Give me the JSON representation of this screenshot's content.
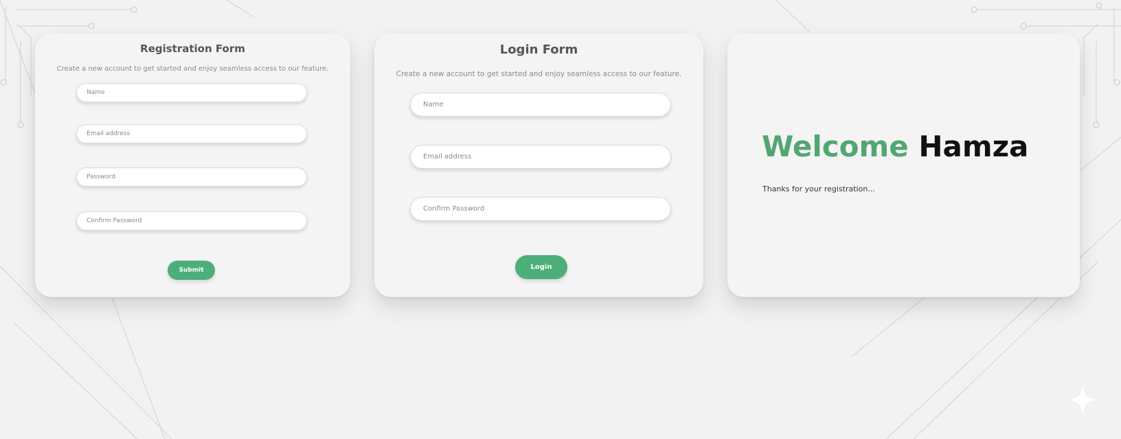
{
  "registration": {
    "title": "Registration Form",
    "subtitle": "Create a new account to get started and enjoy seamless access to our feature.",
    "name_placeholder": "Name",
    "email_placeholder": "Email address",
    "password_placeholder": "Password",
    "confirm_placeholder": "Confirm Password",
    "submit_label": "Submit"
  },
  "login": {
    "title": "Login Form",
    "subtitle": "Create a new account to get started and enjoy seamless access to our feature.",
    "name_placeholder": "Name",
    "email_placeholder": "Email address",
    "confirm_placeholder": "Confirm Password",
    "login_label": "Login"
  },
  "welcome": {
    "greeting": "Welcome",
    "name": "Hamza",
    "message": "Thanks for your registration..."
  },
  "colors": {
    "accent_green": "#4caf79",
    "background": "#f2f2f2"
  }
}
